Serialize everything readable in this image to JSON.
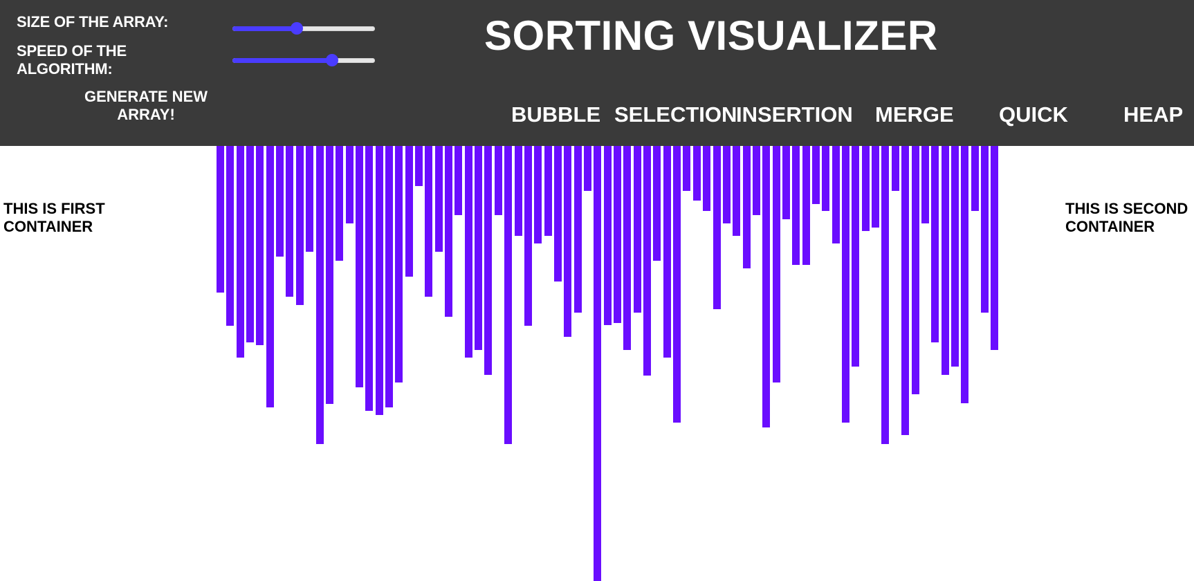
{
  "controls": {
    "size_label": "SIZE OF THE ARRAY:",
    "size_value": 0.45,
    "speed_label_line1": "SPEED OF THE",
    "speed_label_line2": "ALGORITHM:",
    "speed_value": 0.7,
    "generate_line1": "GENERATE NEW",
    "generate_line2": "ARRAY!"
  },
  "title": "SORTING VISUALIZER",
  "algorithms": [
    "BUBBLE",
    "SELECTION",
    "INSERTION",
    "MERGE",
    "QUICK",
    "HEAP"
  ],
  "containers": {
    "first_line1": "THIS IS FIRST",
    "first_line2": "CONTAINER",
    "second_line1": "THIS IS SECOND",
    "second_line2": "CONTAINER"
  },
  "colors": {
    "header_bg": "#3a3a3a",
    "bar": "#6a0dff",
    "slider_accent": "#4a3cff"
  },
  "array": {
    "values": [
      212,
      260,
      306,
      284,
      288,
      378,
      160,
      218,
      230,
      153,
      431,
      373,
      166,
      112,
      349,
      383,
      389,
      378,
      342,
      189,
      58,
      218,
      153,
      247,
      100,
      306,
      295,
      331,
      100,
      431,
      130,
      260,
      141,
      130,
      196,
      276,
      241,
      65,
      629,
      259,
      256,
      295,
      241,
      332,
      166,
      306,
      400,
      65,
      79,
      94,
      236,
      112,
      130,
      177,
      100,
      407,
      342,
      106,
      172,
      172,
      84,
      94,
      141,
      400,
      319,
      123,
      118,
      431,
      65,
      418,
      359,
      112,
      284,
      331,
      319,
      372,
      94,
      241,
      295
    ]
  }
}
